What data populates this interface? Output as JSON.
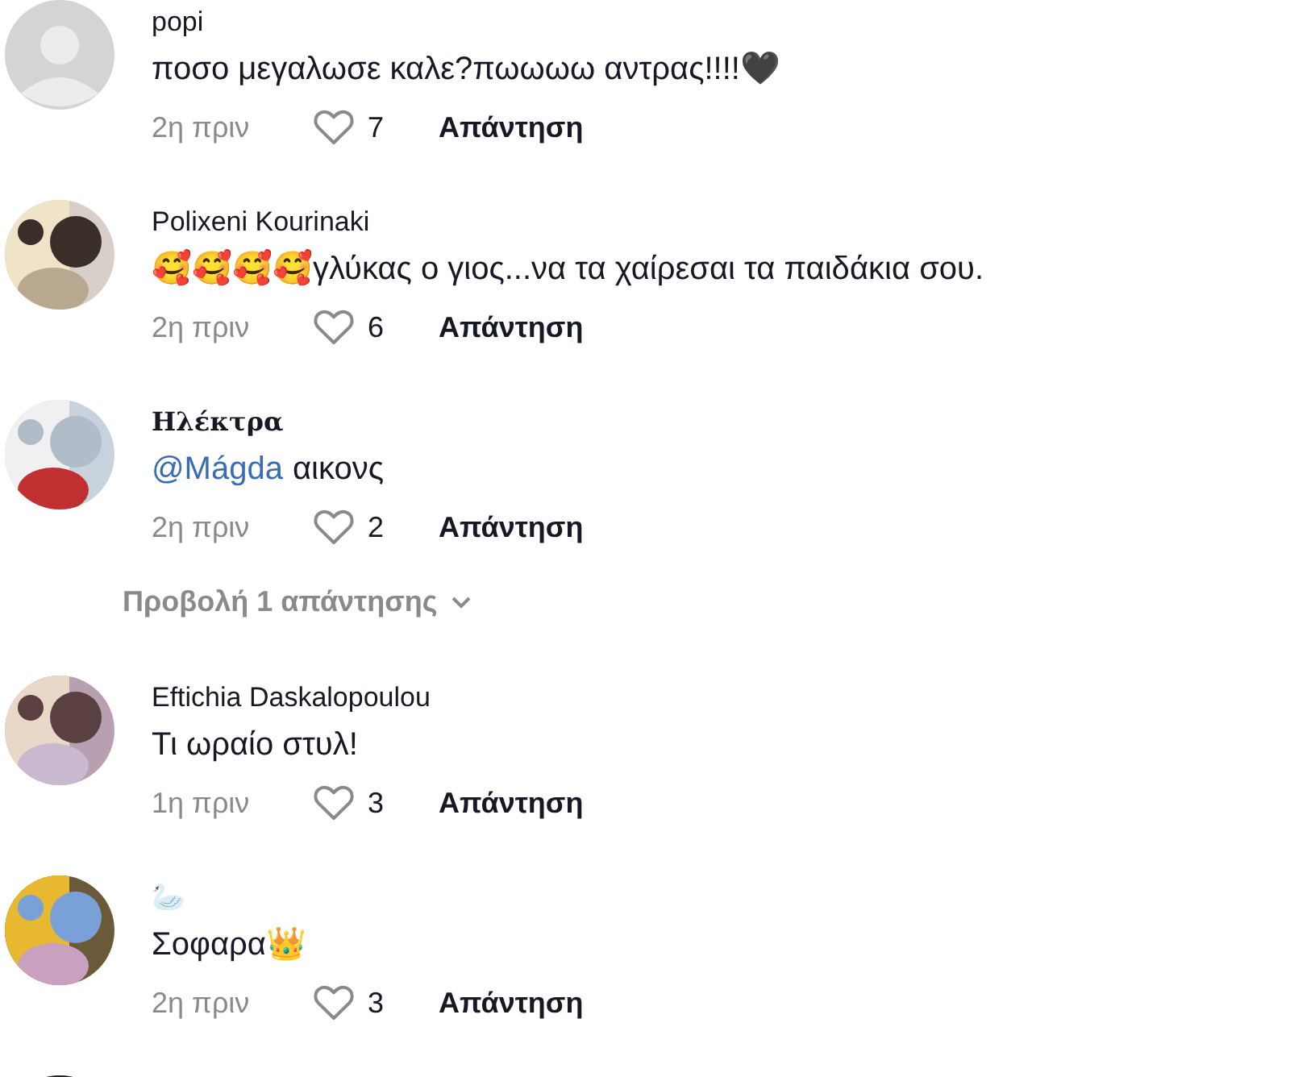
{
  "comments": [
    {
      "name": {
        "text": "popi",
        "kind": "sans"
      },
      "avatar": {
        "kind": "default"
      },
      "text": "ποσο μεγαλωσε καλε?πωωωω αντρας!!!!🖤",
      "time": "2η πριν",
      "likes": "7",
      "reply": "Απάντηση"
    },
    {
      "name": {
        "text": "Polixeni Kourinaki",
        "kind": "sans"
      },
      "text": "🥰🥰🥰🥰γλύκας ο γιος...να τα χαίρεσαι τα παιδάκια σου.",
      "time": "2η πριν",
      "likes": "6",
      "reply": "Απάντηση"
    },
    {
      "name": {
        "text": "Ηλέκτρα",
        "kind": "serif"
      },
      "mention": "@Mágda",
      "text": "αικονς",
      "time": "2η πριν",
      "likes": "2",
      "reply": "Απάντηση",
      "view_replies": "Προβολή 1 απάντησης"
    },
    {
      "name": {
        "text": "Eftichia Daskalopoulou",
        "kind": "sans"
      },
      "text": "Τι ωραίο στυλ!",
      "time": "1η πριν",
      "likes": "3",
      "reply": "Απάντηση"
    },
    {
      "name": {
        "text": "🦢",
        "kind": "sans"
      },
      "text": "Σοφαρα👑",
      "time": "2η πριν",
      "likes": "3",
      "reply": "Απάντηση"
    }
  ]
}
